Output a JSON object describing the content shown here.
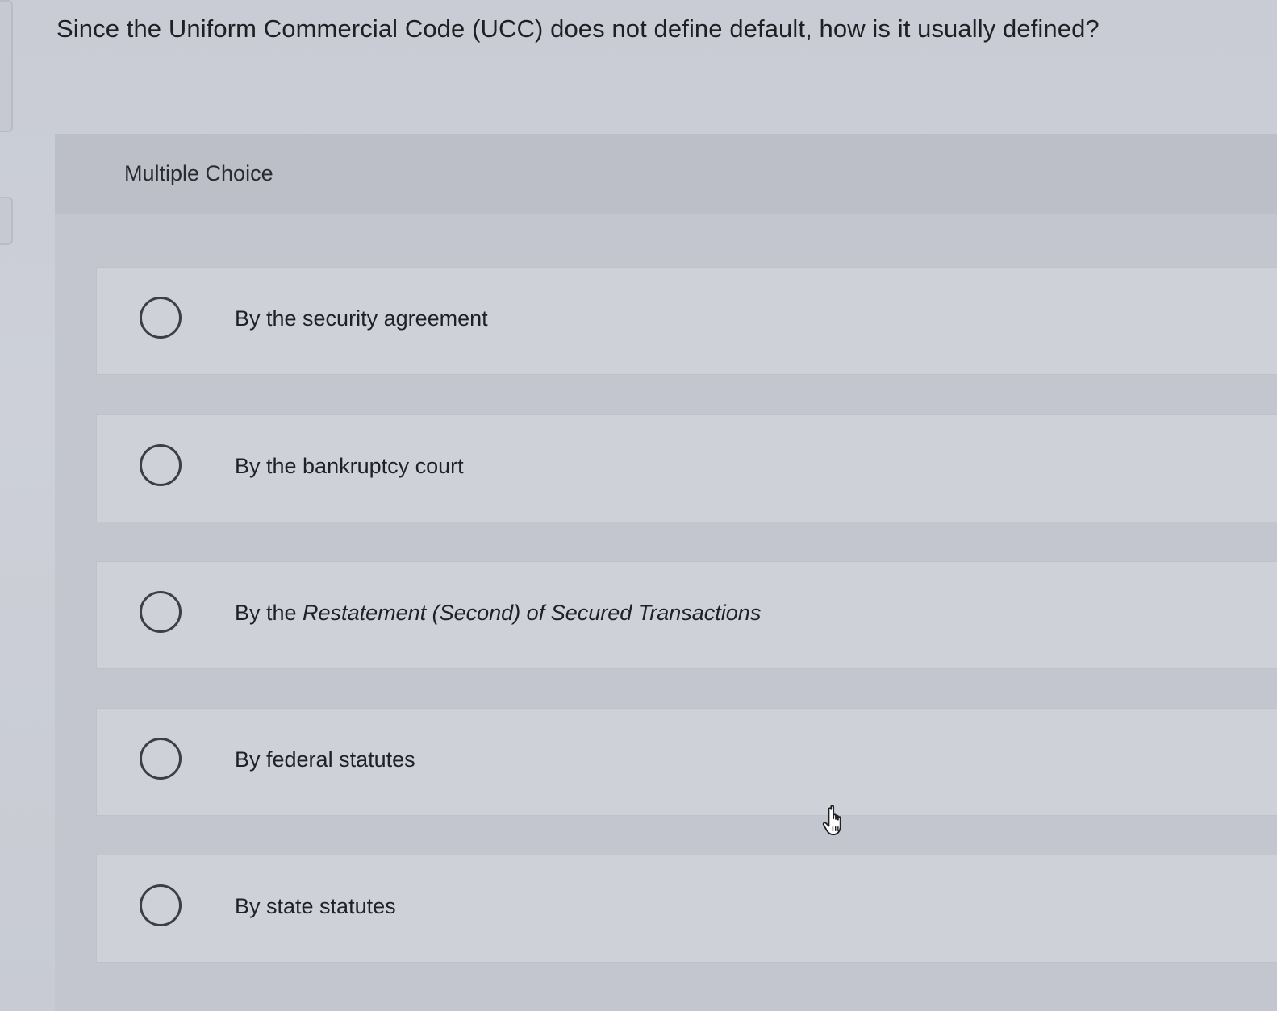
{
  "question": {
    "text": "Since the Uniform Commercial Code (UCC) does not define default, how is it usually defined?"
  },
  "panel": {
    "label": "Multiple Choice"
  },
  "options": [
    {
      "prefix": "By the security agreement",
      "italic": ""
    },
    {
      "prefix": "By the bankruptcy court",
      "italic": ""
    },
    {
      "prefix": "By the ",
      "italic": "Restatement (Second) of Secured Transactions"
    },
    {
      "prefix": "By federal statutes",
      "italic": ""
    },
    {
      "prefix": "By state statutes",
      "italic": ""
    }
  ],
  "icons": {
    "radio": "radio-circle-icon",
    "cursor": "hand-pointer-icon"
  }
}
